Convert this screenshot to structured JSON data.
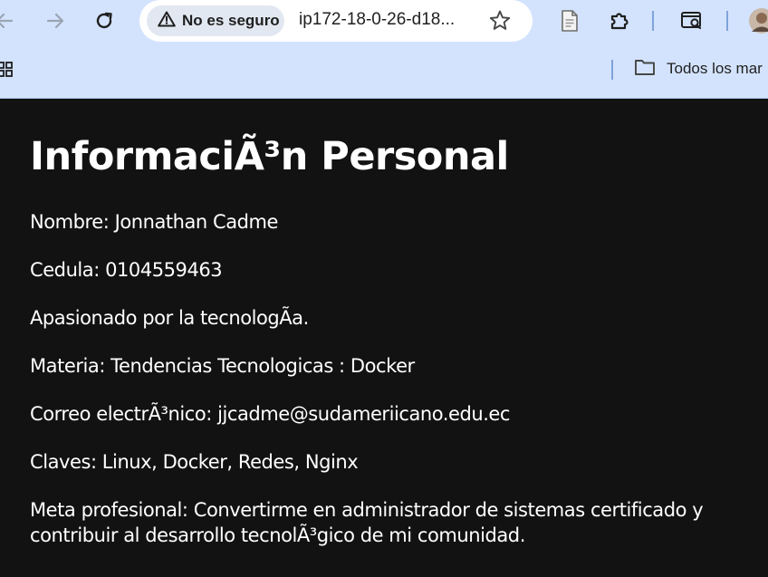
{
  "browser": {
    "security_label": "No es seguro",
    "url": "ip172-18-0-26-d18...",
    "bookmarks_folder_label": "Todos los mar"
  },
  "page": {
    "title": "InformaciÃ³n Personal",
    "lines": [
      "Nombre: Jonnathan Cadme",
      "Cedula: 0104559463",
      "Apasionado por la tecnologÃa.",
      "Materia: Tendencias Tecnologicas : Docker",
      "Correo electrÃ³nico: jjcadme@sudameriicano.edu.ec",
      "Claves: Linux, Docker, Redes, Nginx",
      "Meta profesional: Convertirme en administrador de sistemas certificado y contribuir al desarrollo tecnolÃ³gico de mi comunidad."
    ]
  },
  "colors": {
    "toolbar_bg": "#d3e3fd",
    "page_bg": "#121212",
    "text": "#ffffff"
  }
}
